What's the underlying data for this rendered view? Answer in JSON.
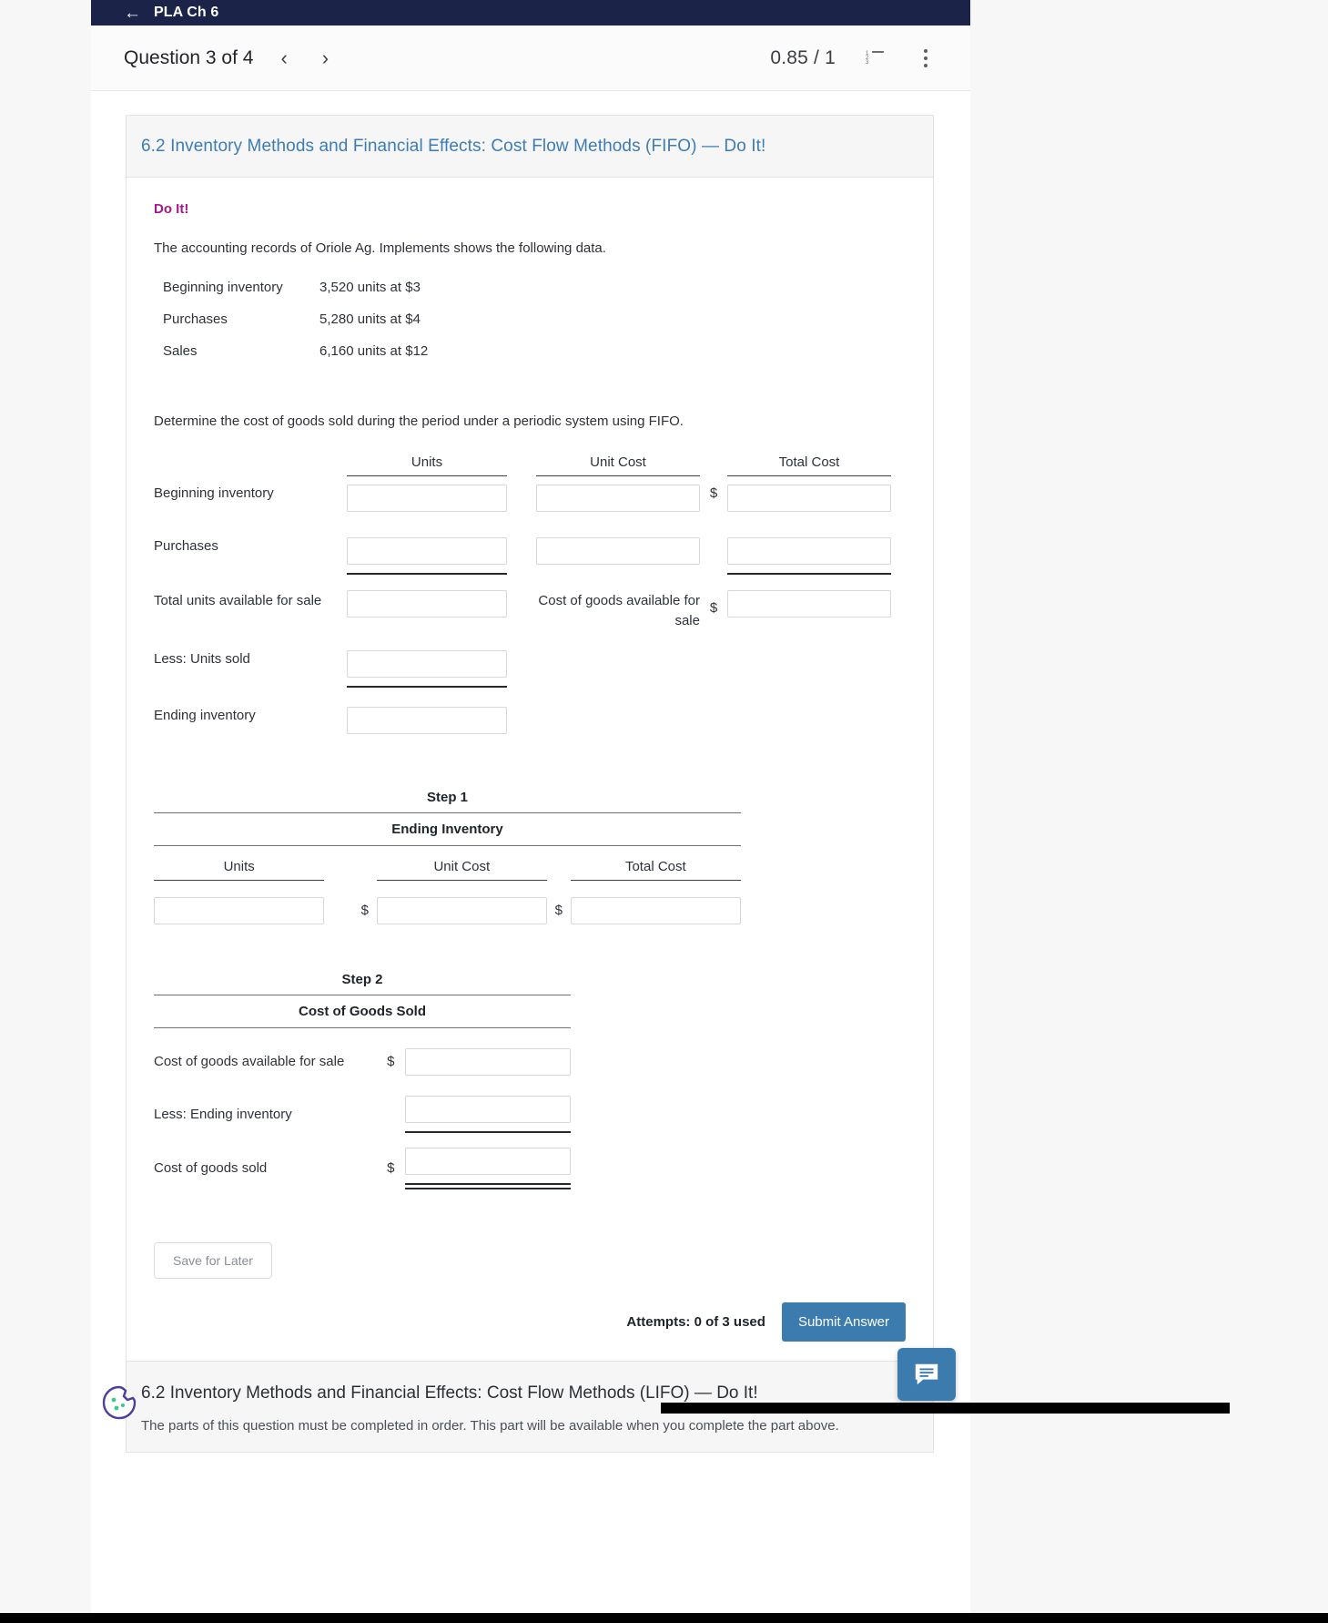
{
  "appbar": {
    "back_icon": "arrow-left-icon",
    "title": "PLA Ch 6"
  },
  "questionbar": {
    "label": "Question 3 of 4",
    "prev_icon": "chevron-left-icon",
    "next_icon": "chevron-right-icon",
    "score": "0.85 / 1",
    "list_icon": "numbered-list-icon",
    "menu_icon": "kebab-menu-icon"
  },
  "card": {
    "title": "6.2 Inventory Methods and Financial Effects: Cost Flow Methods (FIFO) — Do It!",
    "doit_label": "Do It!",
    "intro": "The accounting records of Oriole Ag. Implements shows the following data.",
    "given": [
      {
        "label": "Beginning inventory",
        "value": "3,520 units at $3"
      },
      {
        "label": "Purchases",
        "value": "5,280 units at $4"
      },
      {
        "label": "Sales",
        "value": "6,160 units at $12"
      }
    ],
    "prompt": "Determine the cost of goods sold during the period under a periodic system using FIFO.",
    "main_table": {
      "headers": {
        "units": "Units",
        "unit_cost": "Unit Cost",
        "total_cost": "Total Cost"
      },
      "rows": [
        {
          "label": "Beginning inventory",
          "units_value": "",
          "unit_cost_value": "",
          "total_dollar": "$",
          "total_value": ""
        },
        {
          "label": "Purchases",
          "units_value": "",
          "unit_cost_value": "",
          "total_dollar": "",
          "total_value": ""
        },
        {
          "label": "Total units available for sale",
          "units_value": "",
          "note": "Cost of goods available for sale",
          "total_dollar": "$",
          "total_value": ""
        },
        {
          "label": "Less: Units sold",
          "units_value": ""
        },
        {
          "label": "Ending inventory",
          "units_value": ""
        }
      ]
    },
    "step1": {
      "step_label": "Step 1",
      "section_label": "Ending Inventory",
      "headers": {
        "units": "Units",
        "unit_cost": "Unit Cost",
        "total_cost": "Total Cost"
      },
      "dollar1": "$",
      "dollar2": "$",
      "units_value": "",
      "unit_cost_value": "",
      "total_cost_value": ""
    },
    "step2": {
      "step_label": "Step 2",
      "section_label": "Cost of Goods Sold",
      "rows": [
        {
          "label": "Cost of goods available for sale",
          "dollar": "$",
          "value": ""
        },
        {
          "label": "Less: Ending inventory",
          "dollar": "",
          "value": ""
        },
        {
          "label": "Cost of goods sold",
          "dollar": "$",
          "value": ""
        }
      ]
    },
    "footer": {
      "save_label": "Save for Later",
      "attempts": "Attempts: 0 of 3 used",
      "submit_label": "Submit Answer"
    }
  },
  "next_card": {
    "title": "6.2 Inventory Methods and Financial Effects: Cost Flow Methods (LIFO) — Do It!",
    "subtitle": "The parts of this question must be completed in order. This part will be available when you complete the part above."
  },
  "widgets": {
    "chat_icon": "chat-bubble-icon",
    "cookie_icon": "cookie-consent-icon"
  },
  "colors": {
    "appbar_bg": "#1b2349",
    "title_blue": "#3d7cb5",
    "doit_magenta": "#a01b8d",
    "submit_blue": "#3b7bad"
  }
}
